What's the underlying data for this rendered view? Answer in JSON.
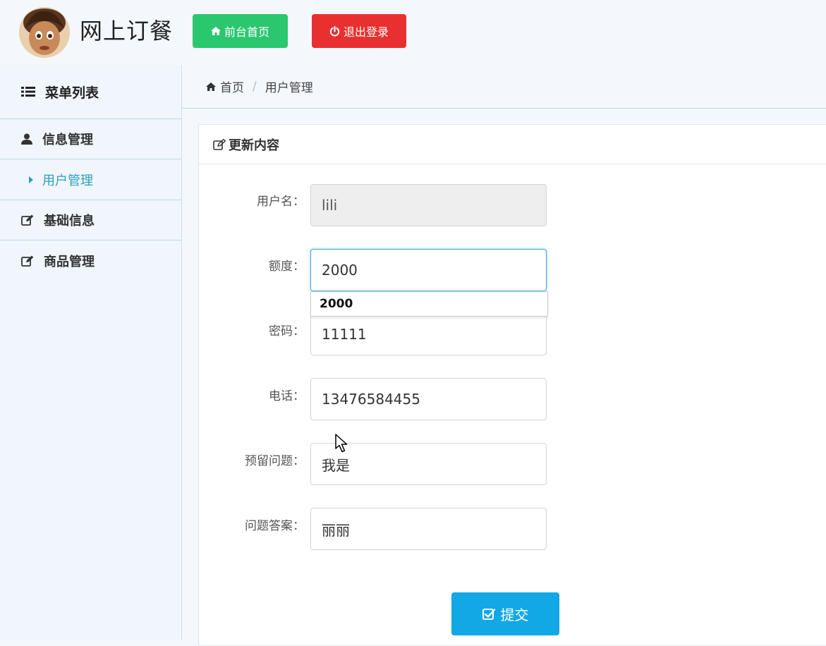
{
  "header": {
    "brand": "网上订餐",
    "home_button": "前台首页",
    "logout_button": "退出登录"
  },
  "sidebar": {
    "title": "菜单列表",
    "items": [
      {
        "label": "信息管理",
        "icon": "user-icon"
      },
      {
        "label": "用户管理",
        "icon": "caret-right-icon"
      },
      {
        "label": "基础信息",
        "icon": "edit-icon"
      },
      {
        "label": "商品管理",
        "icon": "edit-icon"
      }
    ]
  },
  "breadcrumb": {
    "home": "首页",
    "current": "用户管理"
  },
  "panel": {
    "title": "更新内容"
  },
  "form": {
    "fields": [
      {
        "label": "用户名：",
        "value": "lili"
      },
      {
        "label": "额度：",
        "value": "2000"
      },
      {
        "label": "密码：",
        "value": "11111"
      },
      {
        "label": "电话：",
        "value": "13476584455"
      },
      {
        "label": "预留问题：",
        "value": "我是"
      },
      {
        "label": "问题答案：",
        "value": "丽丽"
      }
    ],
    "autocomplete_suggestion": "2000",
    "submit": "提交"
  },
  "colors": {
    "home_button": "#2bc76e",
    "logout_button": "#e93030",
    "submit_button": "#12a8e6",
    "active_link": "#2b9fbd"
  }
}
